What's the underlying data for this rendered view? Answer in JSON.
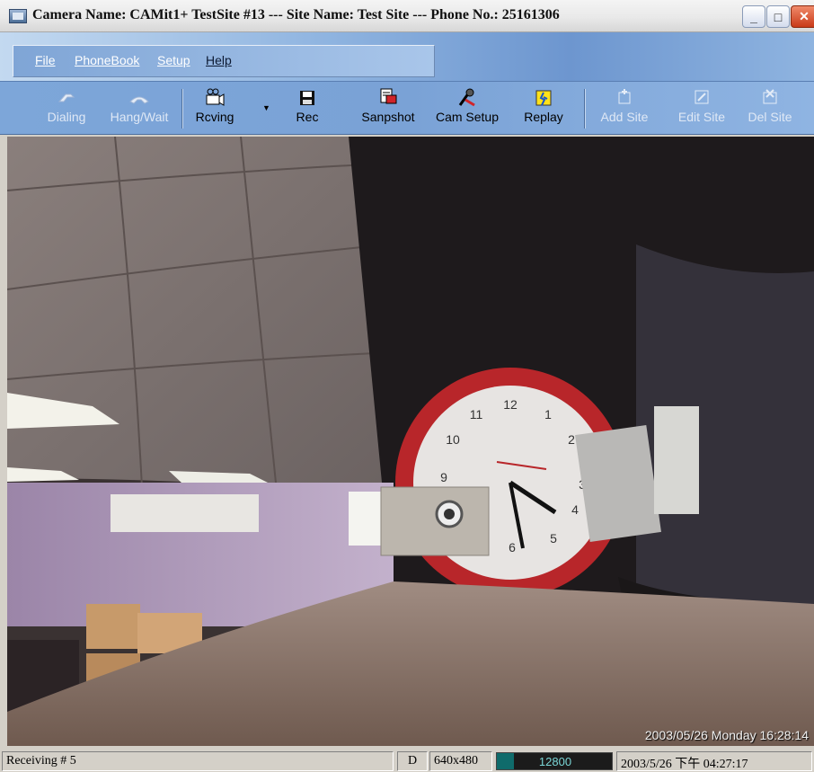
{
  "window": {
    "title": "Camera Name: CAMit1+ TestSite #13 --- Site Name: Test Site --- Phone No.: 25161306",
    "icon": "camera-app-icon",
    "controls": {
      "minimize": "_",
      "maximize": "□",
      "close": "✕"
    }
  },
  "menu": {
    "items": [
      {
        "label": "File",
        "enabled": false
      },
      {
        "label": "PhoneBook",
        "enabled": false
      },
      {
        "label": "Setup",
        "enabled": false
      },
      {
        "label": "Help",
        "enabled": true
      }
    ]
  },
  "toolbar": {
    "dialing": {
      "label": "Dialing",
      "icon": "phone-dial-icon",
      "enabled": false
    },
    "hangwait": {
      "label": "Hang/Wait",
      "icon": "phone-hang-icon",
      "enabled": false
    },
    "receiving": {
      "label": "Rcving",
      "icon": "receiving-camera-icon",
      "enabled": true
    },
    "rec": {
      "label": "Rec",
      "icon": "floppy-disk-icon",
      "enabled": true
    },
    "snapshot": {
      "label": "Sanpshot",
      "icon": "snapshot-icon",
      "enabled": true
    },
    "camsetup": {
      "label": "Cam Setup",
      "icon": "cam-setup-icon",
      "enabled": true
    },
    "replay": {
      "label": "Replay",
      "icon": "replay-icon",
      "enabled": true
    },
    "addsite": {
      "label": "Add Site",
      "icon": "add-site-icon",
      "enabled": false
    },
    "editsite": {
      "label": "Edit Site",
      "icon": "edit-site-icon",
      "enabled": false
    },
    "delsite": {
      "label": "Del Site",
      "icon": "delete-site-icon",
      "enabled": false
    }
  },
  "video": {
    "timestamp_overlay": "2003/05/26 Monday 16:28:14"
  },
  "status": {
    "message": "Receiving # 5",
    "mode": "D",
    "resolution": "640x480",
    "bitrate": "12800",
    "bitrate_fill": 0.15,
    "datetime": "2003/5/26 下午 04:27:17"
  },
  "colors": {
    "toolbar_bg": "#7da6d9",
    "progress_fill": "#0f6b6b",
    "clock_rim": "#b8262a"
  }
}
